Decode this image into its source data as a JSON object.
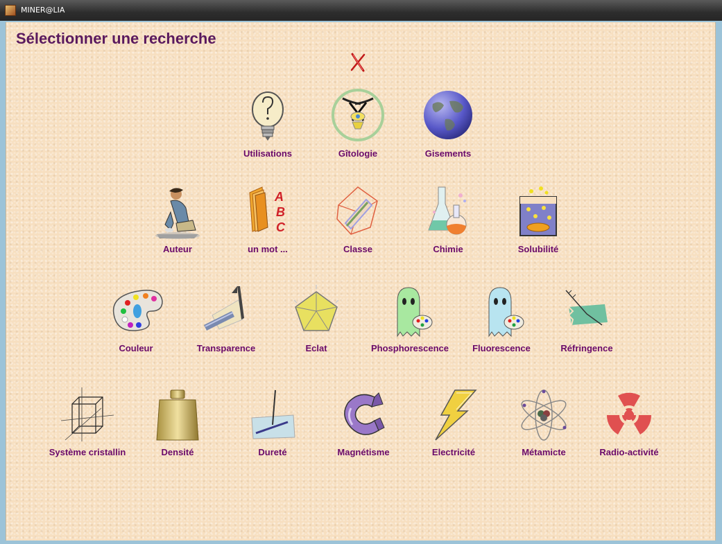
{
  "window": {
    "title": "MINER@LIA"
  },
  "page": {
    "title": "Sélectionner une recherche"
  },
  "close": {
    "label": "X"
  },
  "rows": [
    [
      {
        "label": "Utilisations",
        "icon": "lightbulb-icon"
      },
      {
        "label": "Gîtologie",
        "icon": "pickaxes-icon"
      },
      {
        "label": "Gisements",
        "icon": "globe-icon"
      }
    ],
    [
      {
        "label": "Auteur",
        "icon": "seated-person-icon"
      },
      {
        "label": "un mot ...",
        "icon": "abc-book-icon"
      },
      {
        "label": "Classe",
        "icon": "crystal-class-icon"
      },
      {
        "label": "Chimie",
        "icon": "flask-icon"
      },
      {
        "label": "Solubilité",
        "icon": "beaker-icon"
      }
    ],
    [
      {
        "label": "Couleur",
        "icon": "palette-icon"
      },
      {
        "label": "Transparence",
        "icon": "prism-icon"
      },
      {
        "label": "Eclat",
        "icon": "pentagon-gem-icon"
      },
      {
        "label": "Phosphorescence",
        "icon": "green-ghost-icon"
      },
      {
        "label": "Fluorescence",
        "icon": "blue-ghost-icon"
      },
      {
        "label": "Réfringence",
        "icon": "refraction-icon"
      }
    ],
    [
      {
        "label": "Système cristallin",
        "icon": "cube-axes-icon"
      },
      {
        "label": "Densité",
        "icon": "weight-icon"
      },
      {
        "label": "Dureté",
        "icon": "needle-scratch-icon"
      },
      {
        "label": "Magnétisme",
        "icon": "magnet-icon"
      },
      {
        "label": "Electricité",
        "icon": "lightning-icon"
      },
      {
        "label": "Métamicte",
        "icon": "atom-icon"
      },
      {
        "label": "Radio-activité",
        "icon": "radiation-icon"
      }
    ]
  ]
}
